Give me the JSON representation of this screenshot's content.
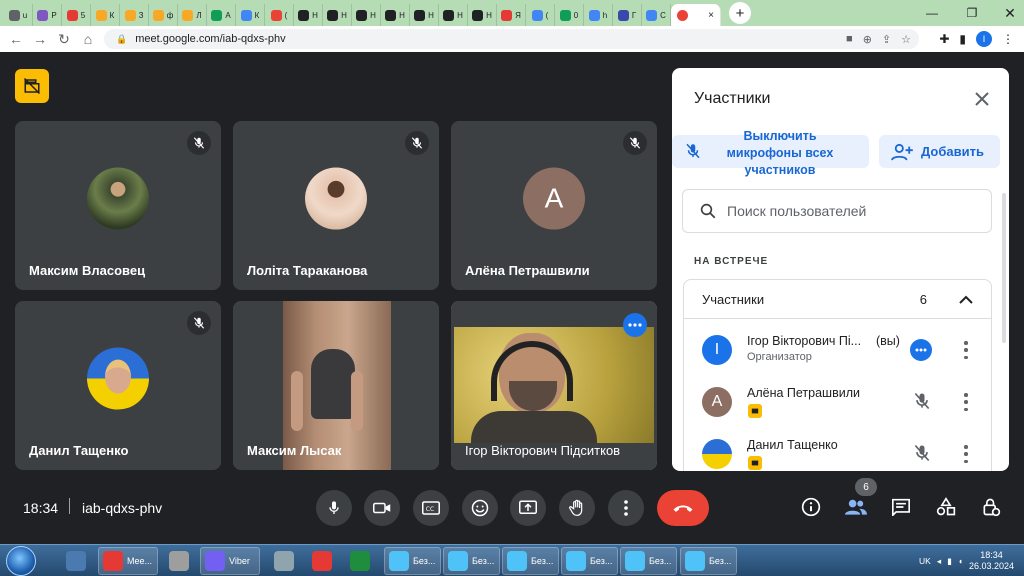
{
  "browser": {
    "tabs": [
      {
        "letter": "u",
        "color": "#5f6368"
      },
      {
        "letter": "P",
        "color": "#7e57c2"
      },
      {
        "letter": "5",
        "color": "#e53935"
      },
      {
        "letter": "К",
        "color": "#f9a825"
      },
      {
        "letter": "З",
        "color": "#f9a825"
      },
      {
        "letter": "ф",
        "color": "#f9a825"
      },
      {
        "letter": "Л",
        "color": "#f9a825"
      },
      {
        "letter": "А",
        "color": "#0f9d58"
      },
      {
        "letter": "К",
        "color": "#4285f4"
      },
      {
        "letter": "(",
        "color": "#ea4335"
      },
      {
        "letter": "Н",
        "color": "#202124"
      },
      {
        "letter": "Н",
        "color": "#202124"
      },
      {
        "letter": "Н",
        "color": "#202124"
      },
      {
        "letter": "Н",
        "color": "#202124"
      },
      {
        "letter": "Н",
        "color": "#202124"
      },
      {
        "letter": "Н",
        "color": "#202124"
      },
      {
        "letter": "Н",
        "color": "#202124"
      },
      {
        "letter": "Я",
        "color": "#e53935"
      },
      {
        "letter": "(",
        "color": "#4285f4"
      },
      {
        "letter": "0",
        "color": "#0f9d58"
      },
      {
        "letter": "h",
        "color": "#4285f4"
      },
      {
        "letter": "Г",
        "color": "#3949ab"
      },
      {
        "letter": "С",
        "color": "#4285f4"
      }
    ],
    "active_tab_x": "×",
    "new_tab": "+",
    "minimize": "—",
    "restore": "❐",
    "url": "meet.google.com/iab-qdxs-phv",
    "profile_initial": "I"
  },
  "tiles": [
    {
      "name": "Максим Власовец",
      "avatar": "photo"
    },
    {
      "name": "Лоліта Тараканова",
      "avatar": "photo"
    },
    {
      "name": "Алёна Петрашвили",
      "avatar": "А"
    },
    {
      "name": "Данил Тащенко",
      "avatar": "photo"
    },
    {
      "name": "Максим Лысак",
      "avatar": "video"
    },
    {
      "name": "Ігор Вікторович Підситков",
      "avatar": "video"
    }
  ],
  "bottom": {
    "time": "18:34",
    "meeting_code": "iab-qdxs-phv",
    "participant_count": "6"
  },
  "panel": {
    "title": "Участники",
    "mute_all": "Выключить микрофоны всех участников",
    "add": "Добавить",
    "search_placeholder": "Поиск пользователей",
    "section": "НА ВСТРЕЧЕ",
    "group_label": "Участники",
    "group_count": "6",
    "people": [
      {
        "initial": "І",
        "name": "Ігор Вікторович Пі...",
        "you": "(вы)",
        "role": "Организатор",
        "color": "#1a73e8"
      },
      {
        "initial": "А",
        "name": "Алёна Петрашвили",
        "color": "#8d6e63"
      },
      {
        "initial": "",
        "name": "Данил Тащенко",
        "color": "#1565c0"
      }
    ]
  },
  "taskbar": {
    "items": [
      {
        "label": "Mee...",
        "color": "#e53935"
      },
      {
        "label": "Viber",
        "color": "#7360f2"
      },
      {
        "label": "Без...",
        "color": "#4fc3f7"
      },
      {
        "label": "Без...",
        "color": "#4fc3f7"
      },
      {
        "label": "Без...",
        "color": "#4fc3f7"
      },
      {
        "label": "Без...",
        "color": "#4fc3f7"
      },
      {
        "label": "Без...",
        "color": "#4fc3f7"
      },
      {
        "label": "Без...",
        "color": "#4fc3f7"
      }
    ],
    "lang": "UK",
    "clock_time": "18:34",
    "clock_date": "26.03.2024"
  }
}
